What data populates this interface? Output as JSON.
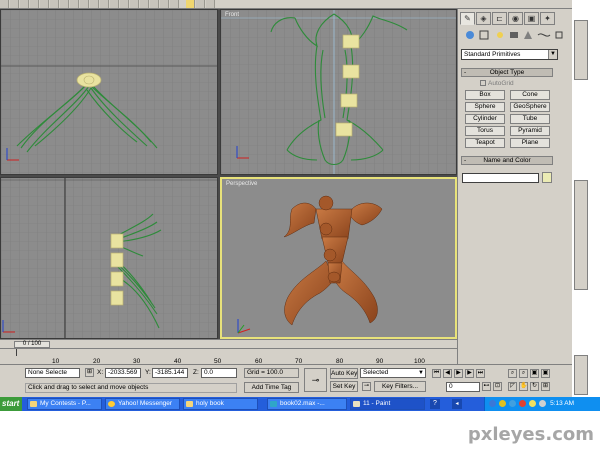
{
  "viewports": {
    "front_label": "Front",
    "perspective_label": "Perspective"
  },
  "command_panel": {
    "primitive_type": "Standard Primitives",
    "object_type_header": "Object Type",
    "autogrid_label": "AutoGrid",
    "buttons": [
      "Box",
      "Cone",
      "Sphere",
      "GeoSphere",
      "Cylinder",
      "Tube",
      "Torus",
      "Pyramid",
      "Teapot",
      "Plane"
    ],
    "name_color_header": "Name and Color",
    "name_value": "",
    "swatch_color": "#ebebb4"
  },
  "timeline": {
    "frame_readout": "0 / 100",
    "ticks": [
      "10",
      "20",
      "30",
      "40",
      "50",
      "60",
      "70",
      "80",
      "90",
      "100"
    ]
  },
  "status": {
    "selection": "None Selecte",
    "x_label": "X:",
    "x_value": "-2033.569",
    "y_label": "Y:",
    "y_value": "-3185.144",
    "z_label": "Z:",
    "z_value": "0.0",
    "grid": "Grid = 100.0",
    "auto_key": "Auto Key",
    "set_key": "Set Key",
    "selected_option": "Selected",
    "key_filters": "Key Filters...",
    "frame_field": "0",
    "prompt": "Click and drag to select and move objects",
    "add_time_tag": "Add Time Tag"
  },
  "taskbar": {
    "start": "start",
    "tasks": [
      {
        "label": "My Contests - P..."
      },
      {
        "label": "Yahoo! Messenger"
      },
      {
        "label": "holy book"
      },
      {
        "label": "book02.max      -..."
      },
      {
        "label": "11 - Paint"
      }
    ],
    "clock": "5:13 AM"
  },
  "watermark": "pxleyes.com",
  "colors": {
    "viewport_bg": "#8c8c8c",
    "model_green": "#2e8b3a",
    "model_yellow": "#e9e3a0",
    "model_orange": "#b5622e",
    "active_border": "#e8e27a"
  }
}
